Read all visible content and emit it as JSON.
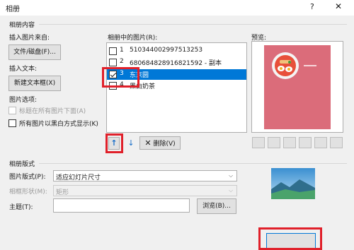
{
  "window": {
    "title": "相册",
    "help": "?",
    "close": "✕"
  },
  "album_content": {
    "group_label": "相册内容",
    "insert_from_label": "插入图片来自:",
    "file_disk_button": "文件/磁盘(F)...",
    "insert_text_label": "插入文本:",
    "new_textbox_button": "新建文本框(X)",
    "picture_options_label": "图片选项:",
    "caption_below_label": "标题在所有图片下面(A)",
    "all_bw_label": "所有图片以黑白方式显示(K)"
  },
  "pictures": {
    "label": "相册中的图片(R):",
    "items": [
      {
        "num": "1",
        "name": "510344002997513253",
        "checked": false,
        "selected": false
      },
      {
        "num": "2",
        "name": "680684828916821592 - 副本",
        "checked": false,
        "selected": false
      },
      {
        "num": "3",
        "name": "东京圆",
        "checked": true,
        "selected": true
      },
      {
        "num": "4",
        "name": "黑白奶茶",
        "checked": false,
        "selected": false
      }
    ],
    "up_glyph": "↑",
    "down_glyph": "↓",
    "delete_glyph": "✕",
    "delete_label": "删除(V)"
  },
  "preview": {
    "label": "预览:",
    "bg_color": "#db6c7a",
    "plate_color": "#e8503a"
  },
  "album_layout": {
    "group_label": "相册版式",
    "layout_label": "图片版式(P):",
    "layout_value": "适应幻灯片尺寸",
    "frame_label": "相框形状(M):",
    "frame_value": "矩形",
    "theme_label": "主题(T):",
    "theme_value": "",
    "browse_button": "浏览(B)..."
  },
  "colors": {
    "accent": "#0078d7",
    "highlight_box": "#e0202a"
  }
}
